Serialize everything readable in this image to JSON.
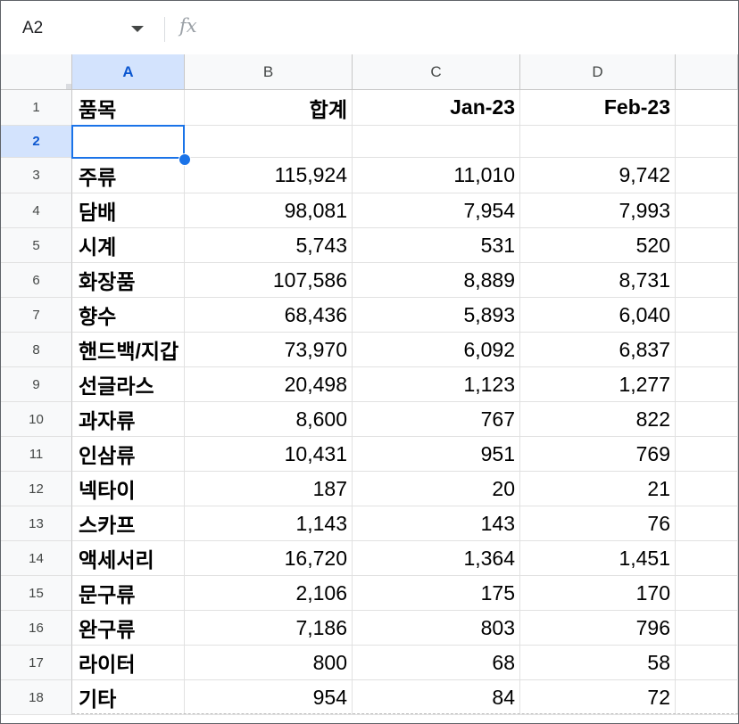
{
  "formula_bar": {
    "name_box": "A2",
    "fx_label": "fx",
    "content": ""
  },
  "columns": [
    "A",
    "B",
    "C",
    "D"
  ],
  "selected_column": "A",
  "selected_row": 2,
  "header": {
    "row": 1,
    "cells": [
      "품목",
      "합계",
      "Jan-23",
      "Feb-23"
    ]
  },
  "blank_row": 2,
  "rows": [
    {
      "row": 3,
      "cells": [
        "주류",
        "115,924",
        "11,010",
        "9,742"
      ]
    },
    {
      "row": 4,
      "cells": [
        "담배",
        "98,081",
        "7,954",
        "7,993"
      ]
    },
    {
      "row": 5,
      "cells": [
        "시계",
        "5,743",
        "531",
        "520"
      ]
    },
    {
      "row": 6,
      "cells": [
        "화장품",
        "107,586",
        "8,889",
        "8,731"
      ]
    },
    {
      "row": 7,
      "cells": [
        "향수",
        "68,436",
        "5,893",
        "6,040"
      ]
    },
    {
      "row": 8,
      "cells": [
        "핸드백/지갑",
        "73,970",
        "6,092",
        "6,837"
      ]
    },
    {
      "row": 9,
      "cells": [
        "선글라스",
        "20,498",
        "1,123",
        "1,277"
      ]
    },
    {
      "row": 10,
      "cells": [
        "과자류",
        "8,600",
        "767",
        "822"
      ]
    },
    {
      "row": 11,
      "cells": [
        "인삼류",
        "10,431",
        "951",
        "769"
      ]
    },
    {
      "row": 12,
      "cells": [
        "넥타이",
        "187",
        "20",
        "21"
      ]
    },
    {
      "row": 13,
      "cells": [
        "스카프",
        "1,143",
        "143",
        "76"
      ]
    },
    {
      "row": 14,
      "cells": [
        "액세서리",
        "16,720",
        "1,364",
        "1,451"
      ]
    },
    {
      "row": 15,
      "cells": [
        "문구류",
        "2,106",
        "175",
        "170"
      ]
    },
    {
      "row": 16,
      "cells": [
        "완구류",
        "7,186",
        "803",
        "796"
      ]
    },
    {
      "row": 17,
      "cells": [
        "라이터",
        "800",
        "68",
        "58"
      ]
    },
    {
      "row": 18,
      "cells": [
        "기타",
        "954",
        "84",
        "72"
      ]
    }
  ],
  "colors": {
    "selection": "#1a73e8",
    "selected_header_bg": "#d3e3fd",
    "header_bg": "#f8f9fa",
    "gridline": "#e1e1e1"
  }
}
